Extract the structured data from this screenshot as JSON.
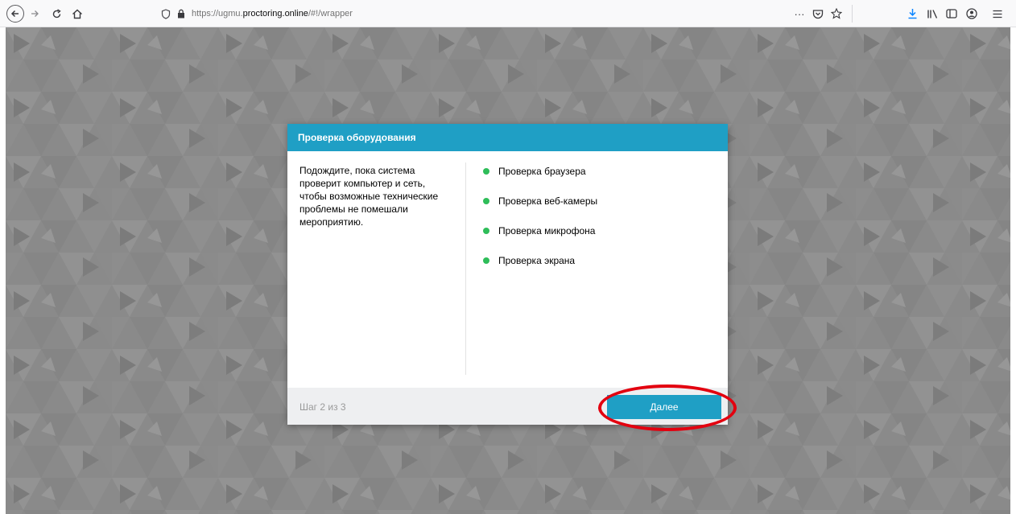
{
  "browser": {
    "url_prefix": "https://ugmu.",
    "url_domain": "proctoring.online",
    "url_suffix": "/#!/wrapper",
    "page_actions_icon": "···"
  },
  "dialog": {
    "title": "Проверка оборудования",
    "description": "Подождите, пока система проверит компьютер и сеть, чтобы возможные технические проблемы не помешали мероприятию.",
    "checks": [
      {
        "label": "Проверка браузера",
        "status": "ok"
      },
      {
        "label": "Проверка веб-камеры",
        "status": "ok"
      },
      {
        "label": "Проверка микрофона",
        "status": "ok"
      },
      {
        "label": "Проверка экрана",
        "status": "ok"
      }
    ],
    "step": "Шаг 2 из 3",
    "next_label": "Далее"
  },
  "colors": {
    "accent": "#1f9fc5",
    "status_ok": "#2ebd59",
    "highlight": "#e3000f",
    "background": "#8c8c8c"
  }
}
